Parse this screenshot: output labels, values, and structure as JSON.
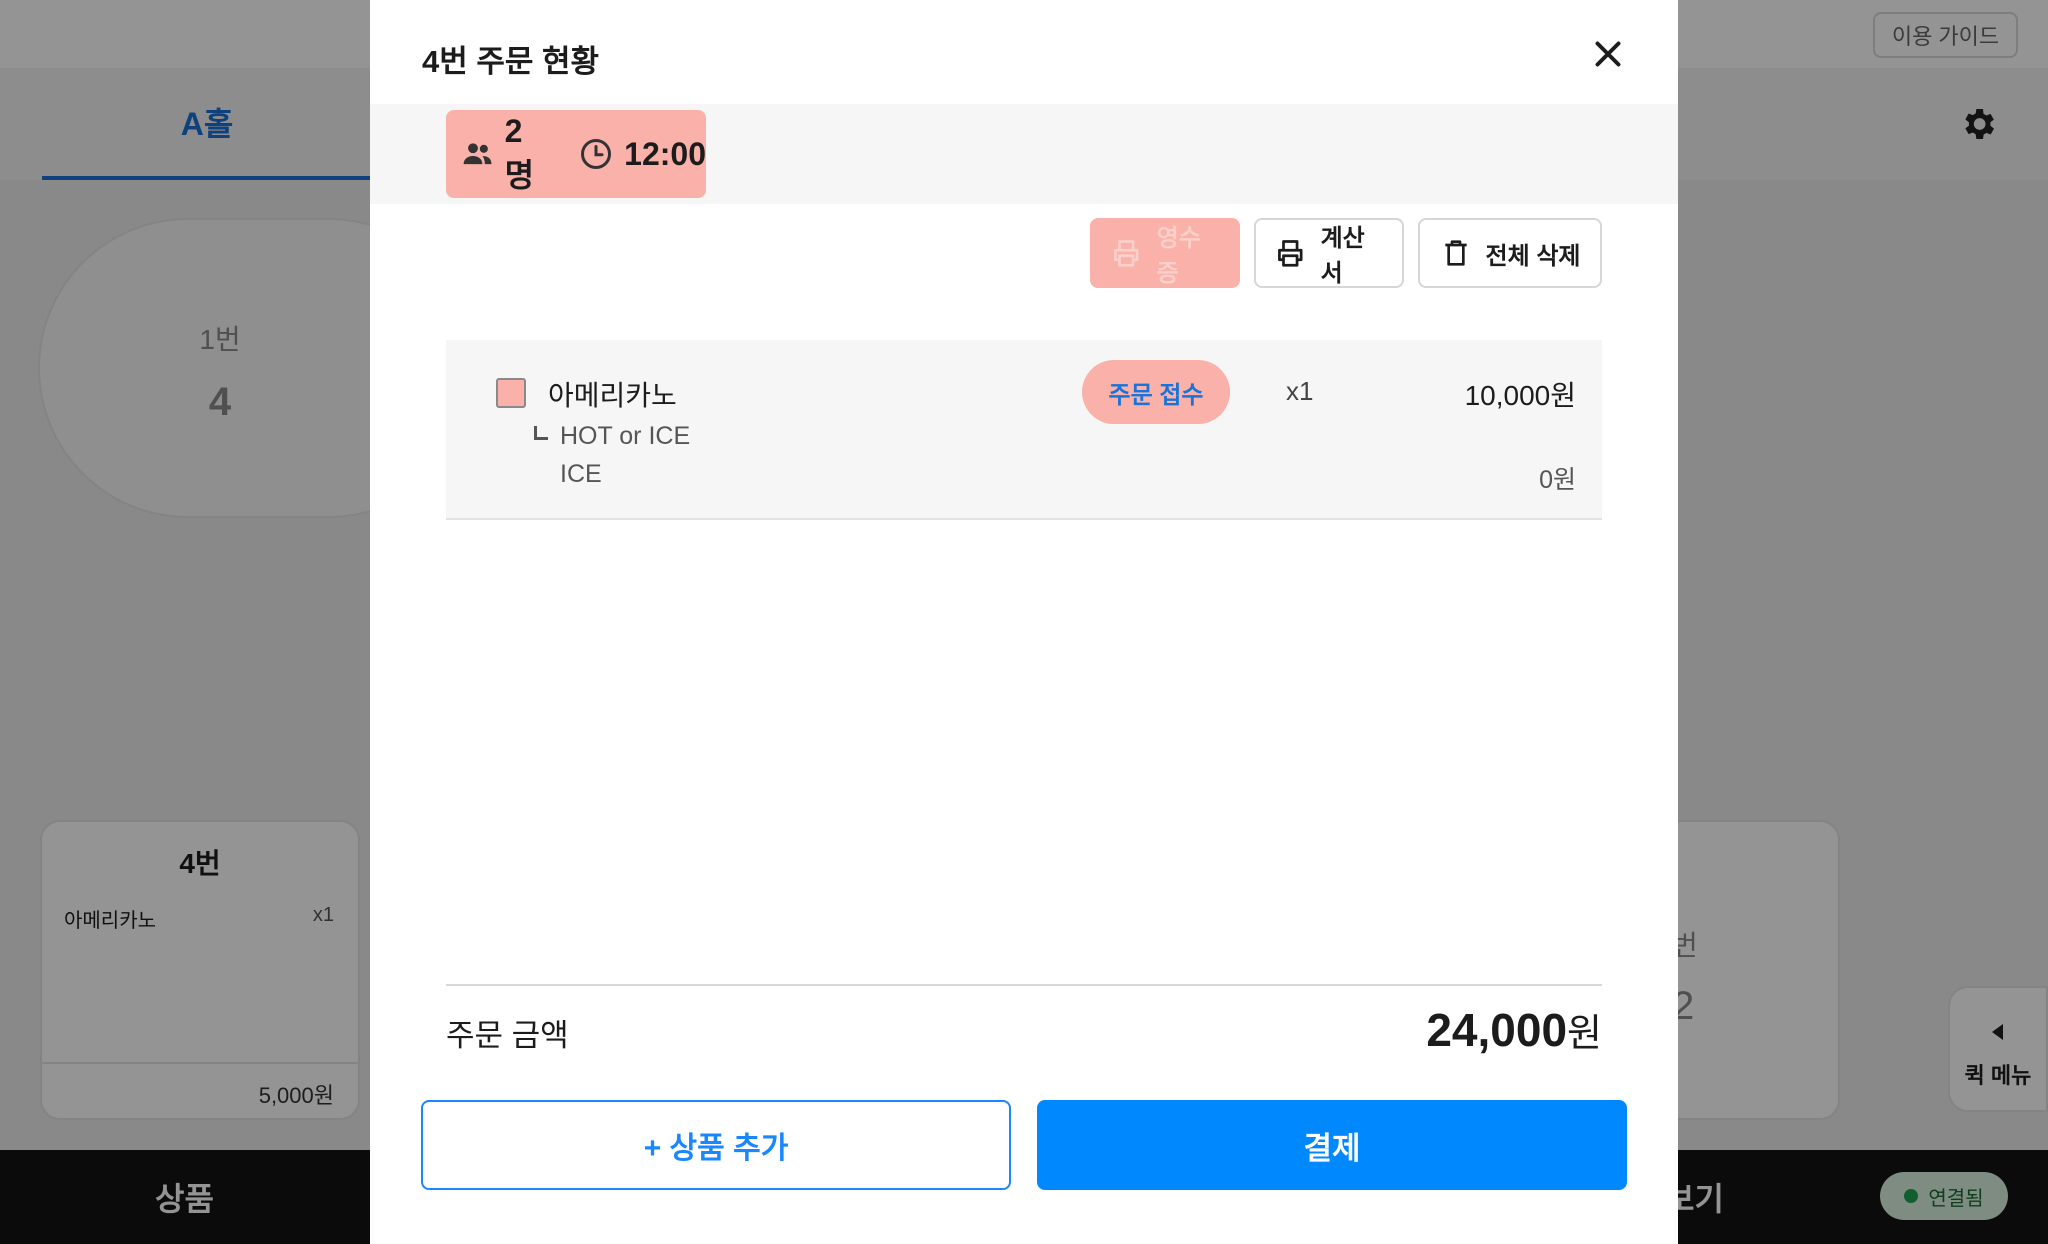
{
  "background": {
    "guide_button": "이용 가이드",
    "hall_tab": "A홀",
    "table1": {
      "name": "1번",
      "count": "4"
    },
    "table4": {
      "title": "4번",
      "item": "아메리카노",
      "qty": "x1",
      "price": "5,000원"
    },
    "partial_table": {
      "name": "번",
      "count": "2"
    },
    "quick_menu": "퀵 메뉴",
    "bottom_left": "상품",
    "bottom_right": "보기",
    "connection": "연결됨"
  },
  "modal": {
    "title": "4번 주문 현황",
    "guests": "2명",
    "time": "12:00",
    "actions": {
      "receipt": "영수증",
      "invoice": "계산서",
      "delete_all": "전체 삭제"
    },
    "order_items": [
      {
        "name": "아메리카노",
        "status": "주문 접수",
        "qty": "x1",
        "price": "10,000원",
        "option_name": "HOT or ICE",
        "option_value": "ICE",
        "option_price": "0원"
      }
    ],
    "total_label": "주문 금액",
    "total_amount": "24,000",
    "total_unit": "원",
    "add_button": "+ 상품 추가",
    "pay_button": "결제"
  },
  "colors": {
    "accent_blue": "#0088ff",
    "highlight_pink": "#f9b1aa",
    "status_text": "#1b72d8"
  }
}
